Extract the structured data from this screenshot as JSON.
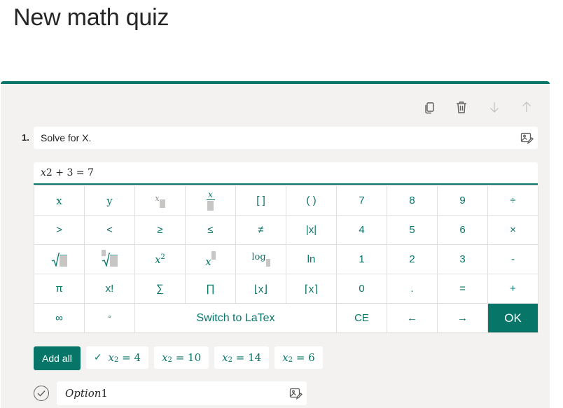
{
  "page": {
    "title": "New math quiz"
  },
  "question": {
    "number": "1.",
    "title": "Solve for X.",
    "formula": {
      "var": "x",
      "rest": "2  + 3 = 7"
    }
  },
  "keypad": {
    "row1": [
      "x",
      "y",
      "",
      "",
      "[ ]",
      "( )",
      "7",
      "8",
      "9",
      "÷"
    ],
    "row2": [
      ">",
      "<",
      "≥",
      "≤",
      "≠",
      "|x|",
      "4",
      "5",
      "6",
      "×"
    ],
    "row3": [
      "",
      "",
      "",
      "",
      "log",
      "ln",
      "1",
      "2",
      "3",
      "-"
    ],
    "row4": [
      "π",
      "x!",
      "∑",
      "∏",
      "⌊x⌋",
      "⌈x⌉",
      "0",
      ".",
      "=",
      "+"
    ],
    "row5": {
      "infinity": "∞",
      "degree": "°",
      "switch": "Switch to LaTex",
      "ce": "CE",
      "left": "←",
      "right": "→",
      "ok": "OK"
    },
    "x": "x",
    "power": "2"
  },
  "suggestions": {
    "add_all": "Add all",
    "check": "✓",
    "var": "x",
    "sub": "2",
    "items": [
      "= 4",
      "= 10",
      "= 14",
      "= 6"
    ]
  },
  "option": {
    "var": "Option",
    "num": "1"
  },
  "colors": {
    "accent": "#077568",
    "card_bg": "#f3f2f1"
  },
  "icons": [
    "copy-icon",
    "trash-icon",
    "arrow-down-icon",
    "arrow-up-icon",
    "image-icon",
    "check-circle-icon"
  ]
}
